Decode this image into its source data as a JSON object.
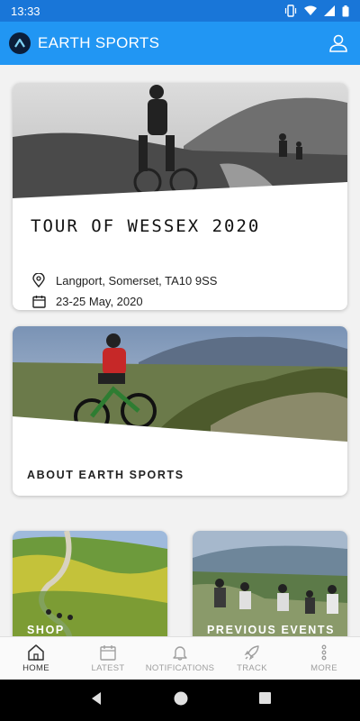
{
  "status_bar": {
    "time": "13:33",
    "icons": [
      "vibrate-icon",
      "wifi-icon",
      "signal-icon",
      "battery-icon"
    ]
  },
  "app_bar": {
    "title": "EARTH SPORTS",
    "logo_icon": "earth-sports-logo-icon",
    "account_icon": "account-icon"
  },
  "featured_event": {
    "title": "TOUR OF WESSEX 2020",
    "location": "Langport, Somerset, TA10 9SS",
    "dates": "23-25 May, 2020",
    "location_icon": "location-pin-icon",
    "date_icon": "calendar-icon"
  },
  "about_card": {
    "label": "ABOUT EARTH SPORTS"
  },
  "tiles": [
    {
      "label": "SHOP"
    },
    {
      "label": "PREVIOUS EVENTS"
    }
  ],
  "bottom_nav": [
    {
      "label": "HOME",
      "icon": "home-icon",
      "active": true
    },
    {
      "label": "LATEST",
      "icon": "calendar-icon",
      "active": false
    },
    {
      "label": "NOTIFICATIONS",
      "icon": "bell-icon",
      "active": false
    },
    {
      "label": "TRACK",
      "icon": "rocket-icon",
      "active": false
    },
    {
      "label": "MORE",
      "icon": "more-vert-icon",
      "active": false
    }
  ],
  "colors": {
    "status_bar": "#1976d8",
    "app_bar": "#2196f3",
    "background": "#f2f2f2",
    "nav_active": "#333333",
    "nav_inactive": "#9e9e9e"
  }
}
